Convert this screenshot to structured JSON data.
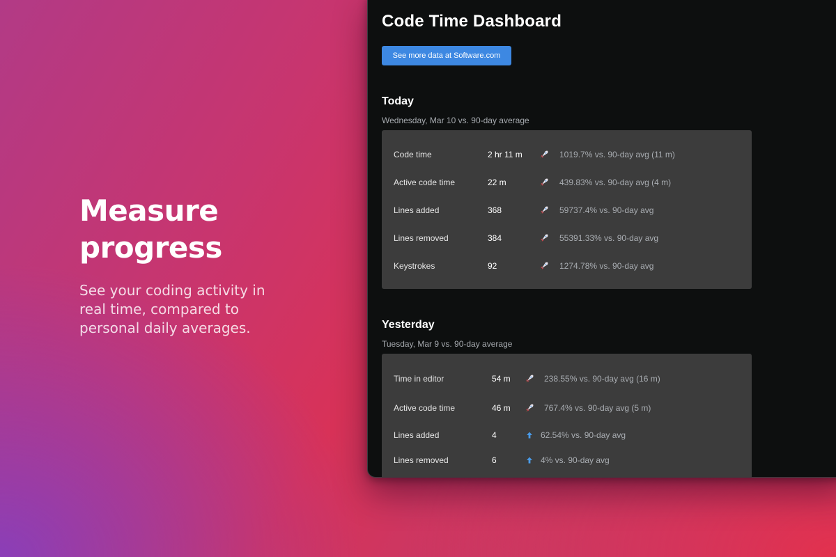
{
  "hero": {
    "title": "Measure progress",
    "subtitle": "See your coding activity in real time, compared to personal daily averages."
  },
  "dashboard": {
    "title": "Code Time Dashboard",
    "cta_label": "See more data at Software.com",
    "accent_color": "#3d88e2",
    "today": {
      "heading": "Today",
      "subheading": "Wednesday, Mar 10 vs. 90-day average",
      "rows": [
        {
          "label": "Code time",
          "value": "2 hr 11 m",
          "icon": "rocket-icon",
          "comparison": "1019.7% vs. 90-day avg (11 m)"
        },
        {
          "label": "Active code time",
          "value": "22 m",
          "icon": "rocket-icon",
          "comparison": "439.83% vs. 90-day avg (4 m)"
        },
        {
          "label": "Lines added",
          "value": "368",
          "icon": "rocket-icon",
          "comparison": "59737.4% vs. 90-day avg"
        },
        {
          "label": "Lines removed",
          "value": "384",
          "icon": "rocket-icon",
          "comparison": "55391.33% vs. 90-day avg"
        },
        {
          "label": "Keystrokes",
          "value": "92",
          "icon": "rocket-icon",
          "comparison": "1274.78% vs. 90-day avg"
        }
      ]
    },
    "yesterday": {
      "heading": "Yesterday",
      "subheading": "Tuesday, Mar 9 vs. 90-day average",
      "rows": [
        {
          "label": "Time in editor",
          "value": "54 m",
          "icon": "rocket-icon",
          "comparison": "238.55% vs. 90-day avg (16 m)"
        },
        {
          "label": "Active code time",
          "value": "46 m",
          "icon": "rocket-icon",
          "comparison": "767.4% vs. 90-day avg (5 m)"
        },
        {
          "label": "Lines added",
          "value": "4",
          "icon": "up-arrow-icon",
          "comparison": "62.54% vs. 90-day avg"
        },
        {
          "label": "Lines removed",
          "value": "6",
          "icon": "up-arrow-icon",
          "comparison": "4% vs. 90-day avg"
        }
      ]
    }
  }
}
